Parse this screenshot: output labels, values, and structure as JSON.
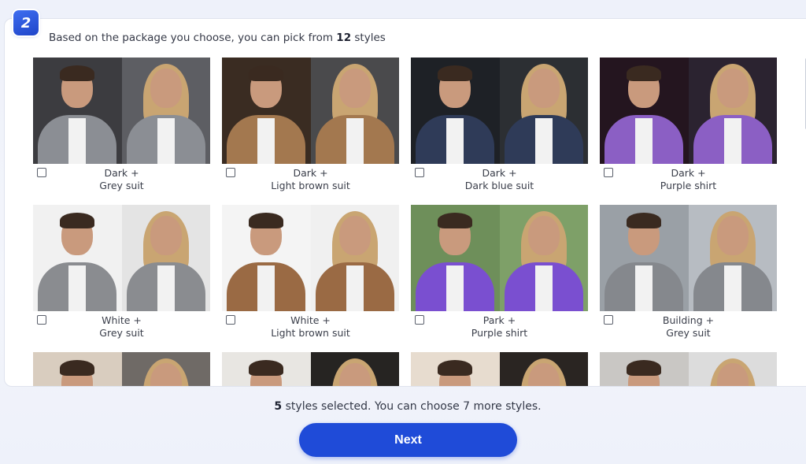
{
  "step": {
    "number": "2"
  },
  "intro": {
    "prefix": "Based on the package you choose, you can pick from",
    "count": "12",
    "suffix": "styles"
  },
  "styles": [
    {
      "line1": "Dark +",
      "line2": "Grey suit",
      "bg": "#3c3c40",
      "bg2": "#5d5e63",
      "suit": "#8b8e94",
      "checked": false
    },
    {
      "line1": "Dark +",
      "line2": "Light brown suit",
      "bg": "#3a2c22",
      "bg2": "#4a4a4c",
      "suit": "#a3784f",
      "checked": false
    },
    {
      "line1": "Dark +",
      "line2": "Dark blue suit",
      "bg": "#1e2126",
      "bg2": "#2c2f33",
      "suit": "#2f3b58",
      "checked": false
    },
    {
      "line1": "Dark +",
      "line2": "Purple shirt",
      "bg": "#24151f",
      "bg2": "#2b2330",
      "suit": "#8b5fc4",
      "checked": false
    },
    {
      "line1": "White +",
      "line2": "Grey suit",
      "bg": "#f1f1f1",
      "bg2": "#e4e4e4",
      "suit": "#8a8c90",
      "checked": false
    },
    {
      "line1": "White +",
      "line2": "Light brown suit",
      "bg": "#f4f4f4",
      "bg2": "#f0f0f0",
      "suit": "#9a6a44",
      "checked": false
    },
    {
      "line1": "Park +",
      "line2": "Purple shirt",
      "bg": "#6e8f5a",
      "bg2": "#7ea068",
      "suit": "#7a4fd0",
      "checked": false
    },
    {
      "line1": "Building +",
      "line2": "Grey suit",
      "bg": "#9aa0a6",
      "bg2": "#b7bcc2",
      "suit": "#85888d",
      "checked": false
    },
    {
      "line1": "",
      "line2": "",
      "bg": "#d9cdbf",
      "bg2": "#6f6a66",
      "suit": "#8a8c90",
      "checked": false
    },
    {
      "line1": "",
      "line2": "",
      "bg": "#e8e6e2",
      "bg2": "#262422",
      "suit": "#8a8c90",
      "checked": false
    },
    {
      "line1": "",
      "line2": "",
      "bg": "#e7dccf",
      "bg2": "#2a2522",
      "suit": "#8a8c90",
      "checked": false
    },
    {
      "line1": "",
      "line2": "",
      "bg": "#c9c7c4",
      "bg2": "#dcdcdc",
      "suit": "#8a8c90",
      "checked": false
    }
  ],
  "footer": {
    "selected": "5",
    "message": "styles selected. You can choose 7 more styles."
  },
  "next_label": "Next"
}
